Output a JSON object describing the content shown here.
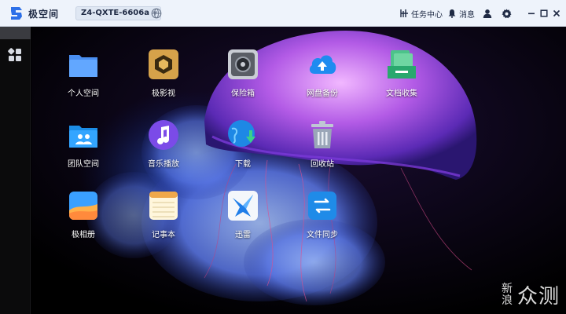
{
  "titlebar": {
    "brand": "极空间",
    "device": "Z4-QXTE-6606a",
    "task_center": "任务中心",
    "messages": "消息"
  },
  "desktop": {
    "apps": [
      {
        "label": "个人空间",
        "icon": "folder-icon"
      },
      {
        "label": "极影视",
        "icon": "video-icon"
      },
      {
        "label": "保险箱",
        "icon": "safe-icon"
      },
      {
        "label": "网盘备份",
        "icon": "cloud-upload-icon"
      },
      {
        "label": "文档收集",
        "icon": "document-stack-icon"
      },
      {
        "label": "团队空间",
        "icon": "team-folder-icon"
      },
      {
        "label": "音乐播放",
        "icon": "music-icon"
      },
      {
        "label": "下载",
        "icon": "download-globe-icon"
      },
      {
        "label": "回收站",
        "icon": "trash-icon"
      },
      {
        "label": "极相册",
        "icon": "photo-album-icon"
      },
      {
        "label": "记事本",
        "icon": "notepad-icon"
      },
      {
        "label": "迅雷",
        "icon": "xunlei-icon"
      },
      {
        "label": "文件同步",
        "icon": "sync-icon"
      }
    ]
  },
  "watermark": {
    "line1": "新",
    "line2": "浪",
    "text": "众测"
  },
  "colors": {
    "titlebar_bg": "#eef3fb",
    "accent": "#1677ff",
    "sidebar_bg": "#0b0b0c"
  }
}
